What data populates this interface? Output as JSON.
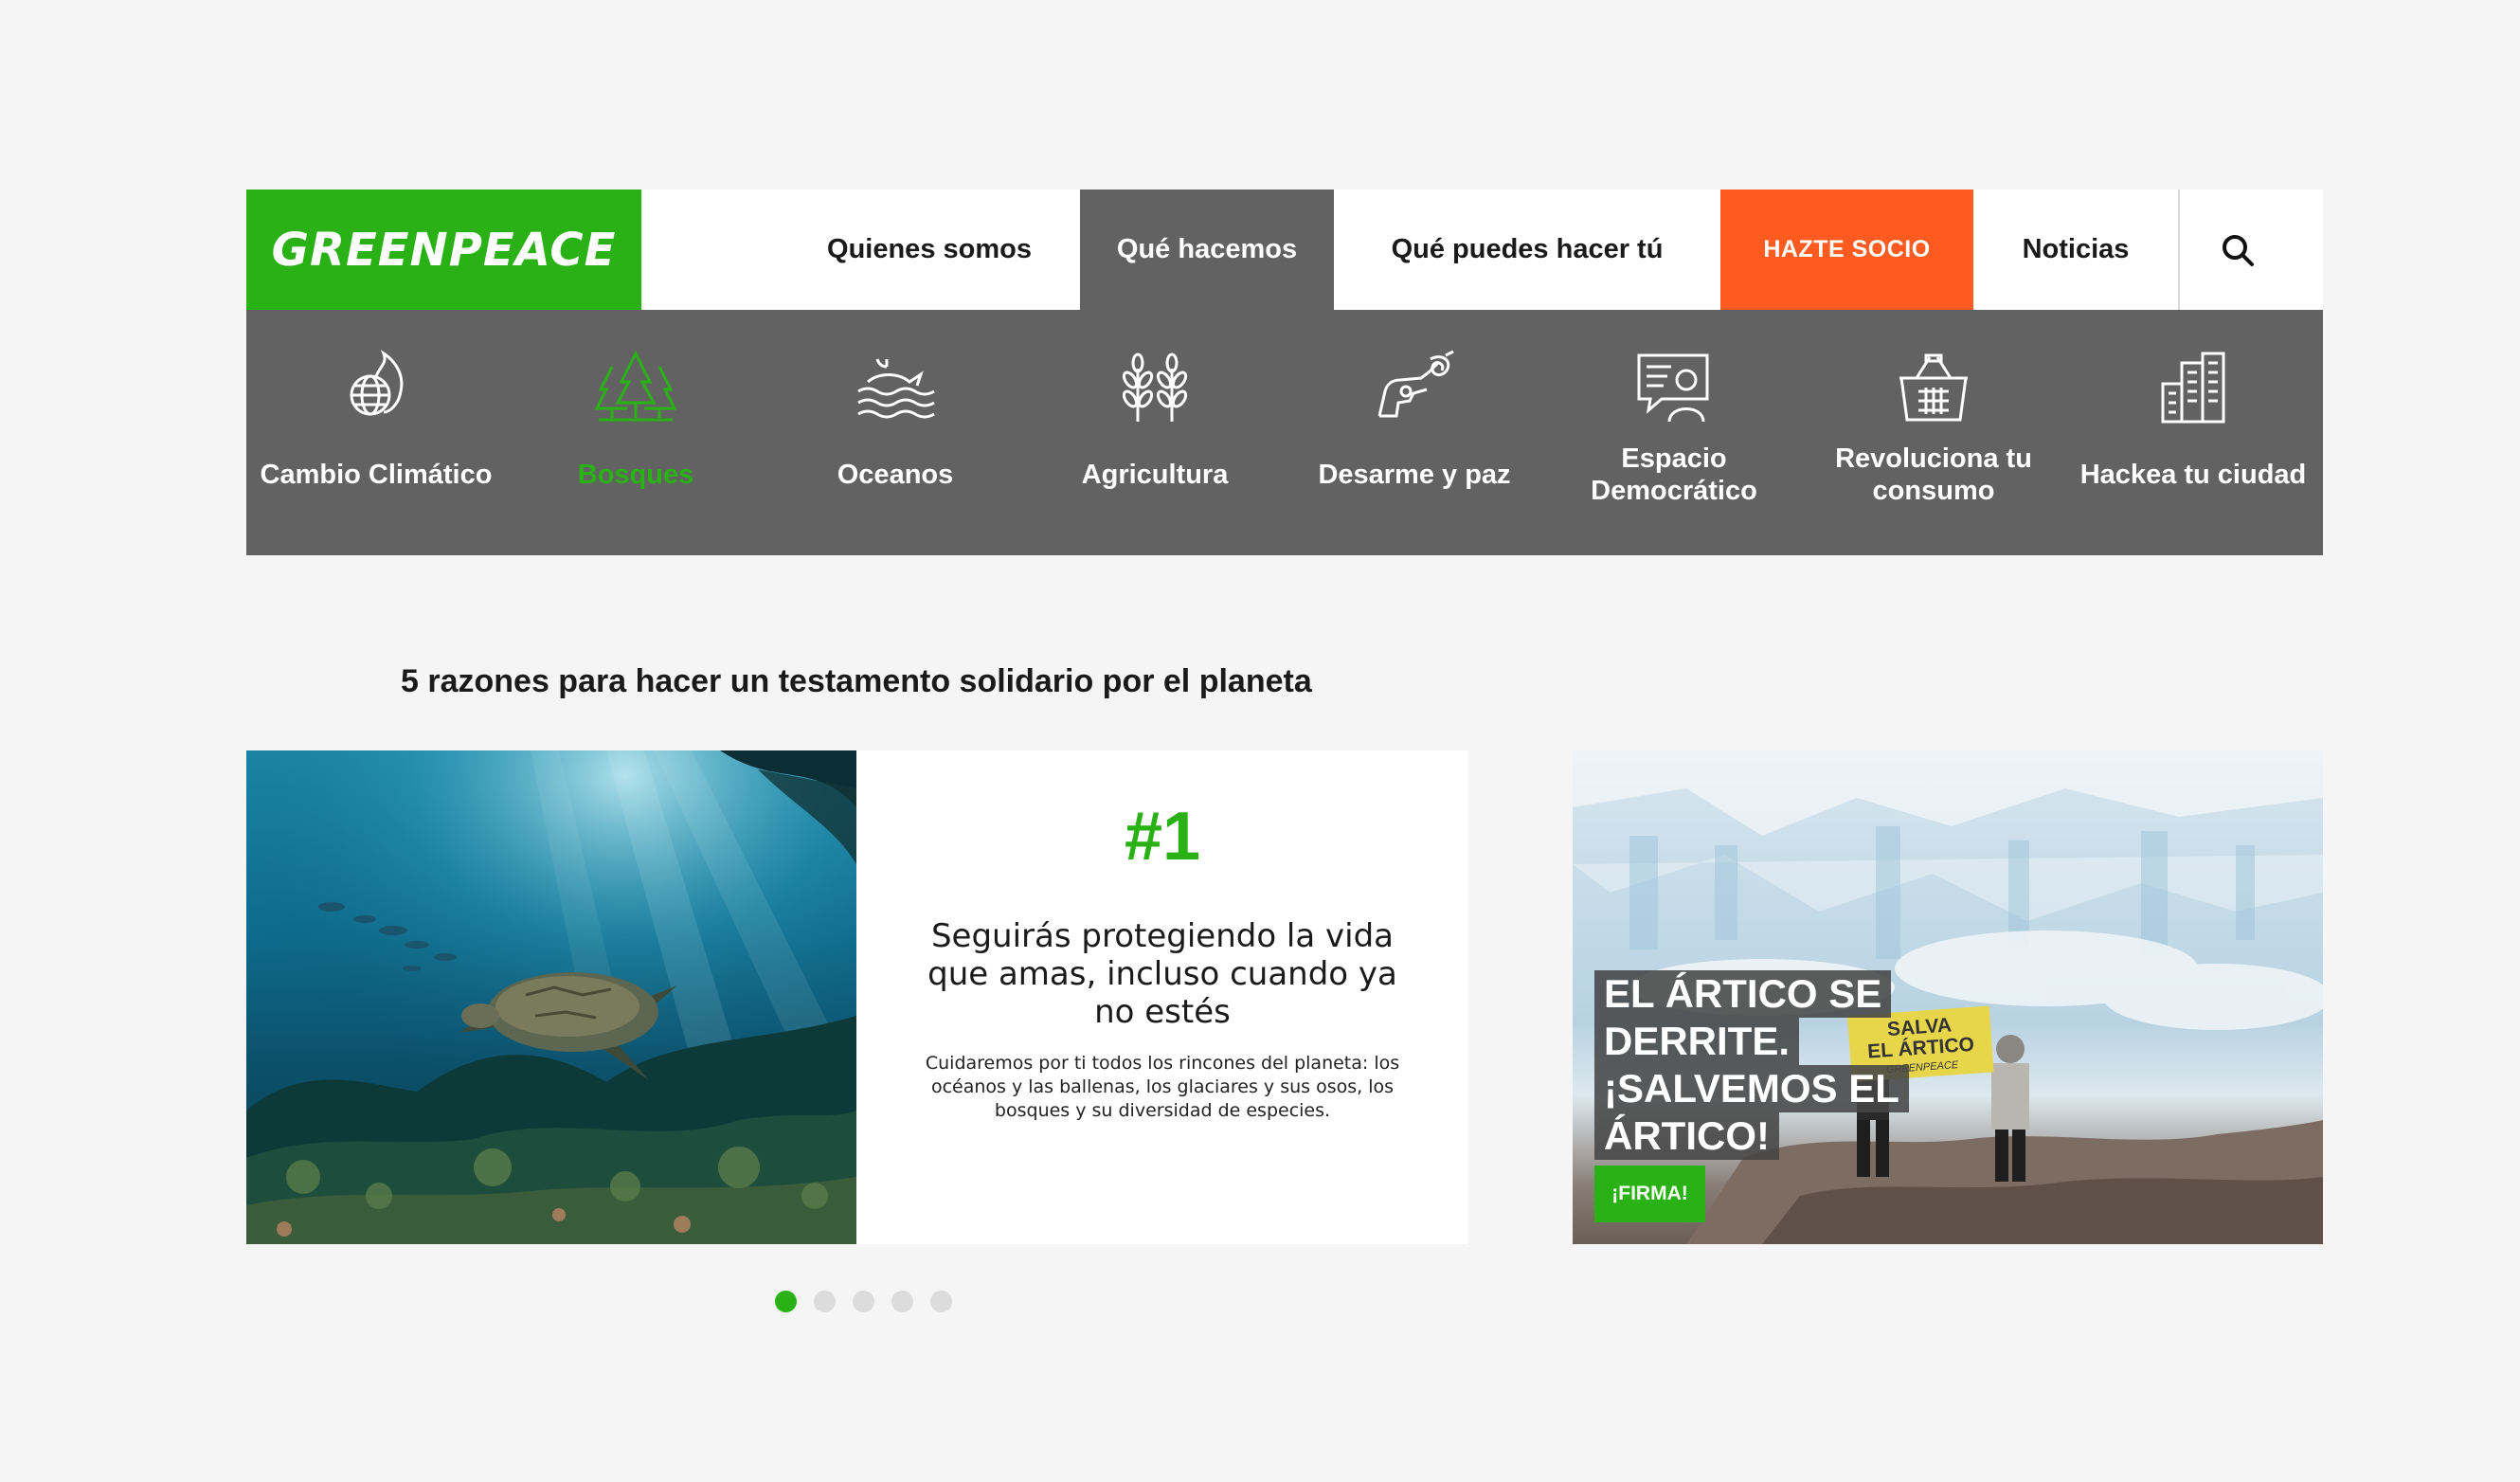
{
  "colors": {
    "brand_green": "#2ab116",
    "nav_dark": "#626262",
    "cta_orange": "#ff5a1f"
  },
  "header": {
    "logo": "GREENPEACE",
    "nav": {
      "quienes": "Quienes somos",
      "que_hacemos": "Qué hacemos",
      "que_puedes": "Qué puedes hacer tú",
      "hazte_socio": "HAZTE SOCIO",
      "noticias": "Noticias"
    },
    "search_icon": "search-icon"
  },
  "categories": [
    {
      "label": "Cambio Climático",
      "icon": "globe-flame-icon"
    },
    {
      "label": "Bosques",
      "icon": "trees-icon",
      "active": true
    },
    {
      "label": "Oceanos",
      "icon": "whale-waves-icon"
    },
    {
      "label": "Agricultura",
      "icon": "wheat-icon"
    },
    {
      "label": "Desarme y paz",
      "icon": "knotted-gun-icon"
    },
    {
      "label": "Espacio Democrático",
      "icon": "speech-person-icon"
    },
    {
      "label": "Revoluciona tu consumo",
      "icon": "basket-icon"
    },
    {
      "label": "Hackea tu ciudad",
      "icon": "buildings-icon"
    }
  ],
  "section": {
    "title": "5 razones para hacer un testamento solidario por el planeta"
  },
  "carousel": {
    "number": "#1",
    "title": "Seguirás protegiendo la vida que amas, incluso cuando ya no estés",
    "text": "Cuidaremos por ti todos los rincones del planeta: los océanos y las ballenas, los glaciares y sus osos, los bosques y su diversidad de especies.",
    "slides_total": 5,
    "active_slide": 1
  },
  "promo": {
    "lines": [
      "EL ÁRTICO SE",
      "DERRITE.",
      "¡SALVEMOS EL",
      "ÁRTICO!"
    ],
    "button": "¡FIRMA!",
    "banner_line1": "SALVA",
    "banner_line2": "EL ÁRTICO",
    "banner_brand": "GREENPEACE"
  }
}
